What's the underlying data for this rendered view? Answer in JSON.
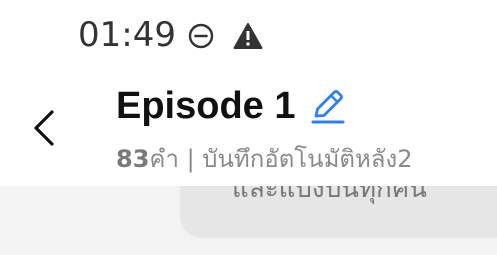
{
  "status_bar": {
    "time": "01:49",
    "icons": [
      "do-not-disturb-icon",
      "warning-icon"
    ]
  },
  "header": {
    "title": "Episode 1",
    "word_count": "83",
    "subtitle_text": "คำ | บันทึกอัตโนมัติหลัง2"
  },
  "content": {
    "note_preview": "และแบ่งปันทุกคน"
  },
  "colors": {
    "accent": "#2f7ff0",
    "title": "#111111",
    "subtitle": "#8a8a8a",
    "content_bg": "#f3f3f3",
    "card_bg": "#e6e6e6"
  }
}
